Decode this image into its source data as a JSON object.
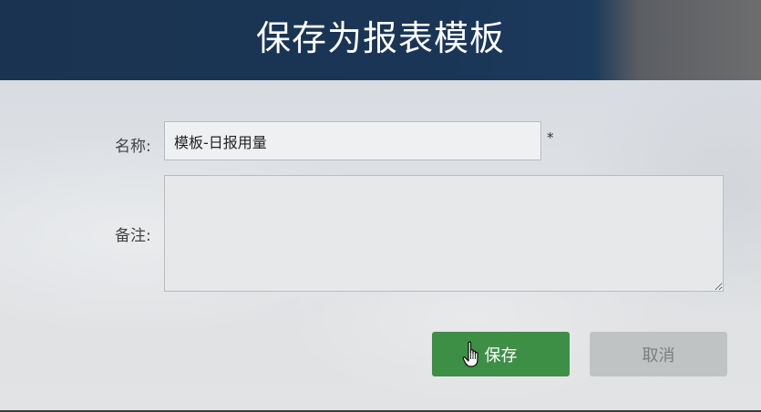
{
  "dialog": {
    "title": "保存为报表模板",
    "fields": {
      "name_label": "名称:",
      "name_value": "模板-日报用量",
      "required_mark": "*",
      "remark_label": "备注:",
      "remark_value": ""
    },
    "buttons": {
      "save_label": "保存",
      "cancel_label": "取消"
    }
  },
  "colors": {
    "header_bg": "#1a3556",
    "save_button": "#3d8f45",
    "cancel_button": "#c0c3c4"
  },
  "icons": {
    "cursor": "hand-pointer-icon"
  }
}
